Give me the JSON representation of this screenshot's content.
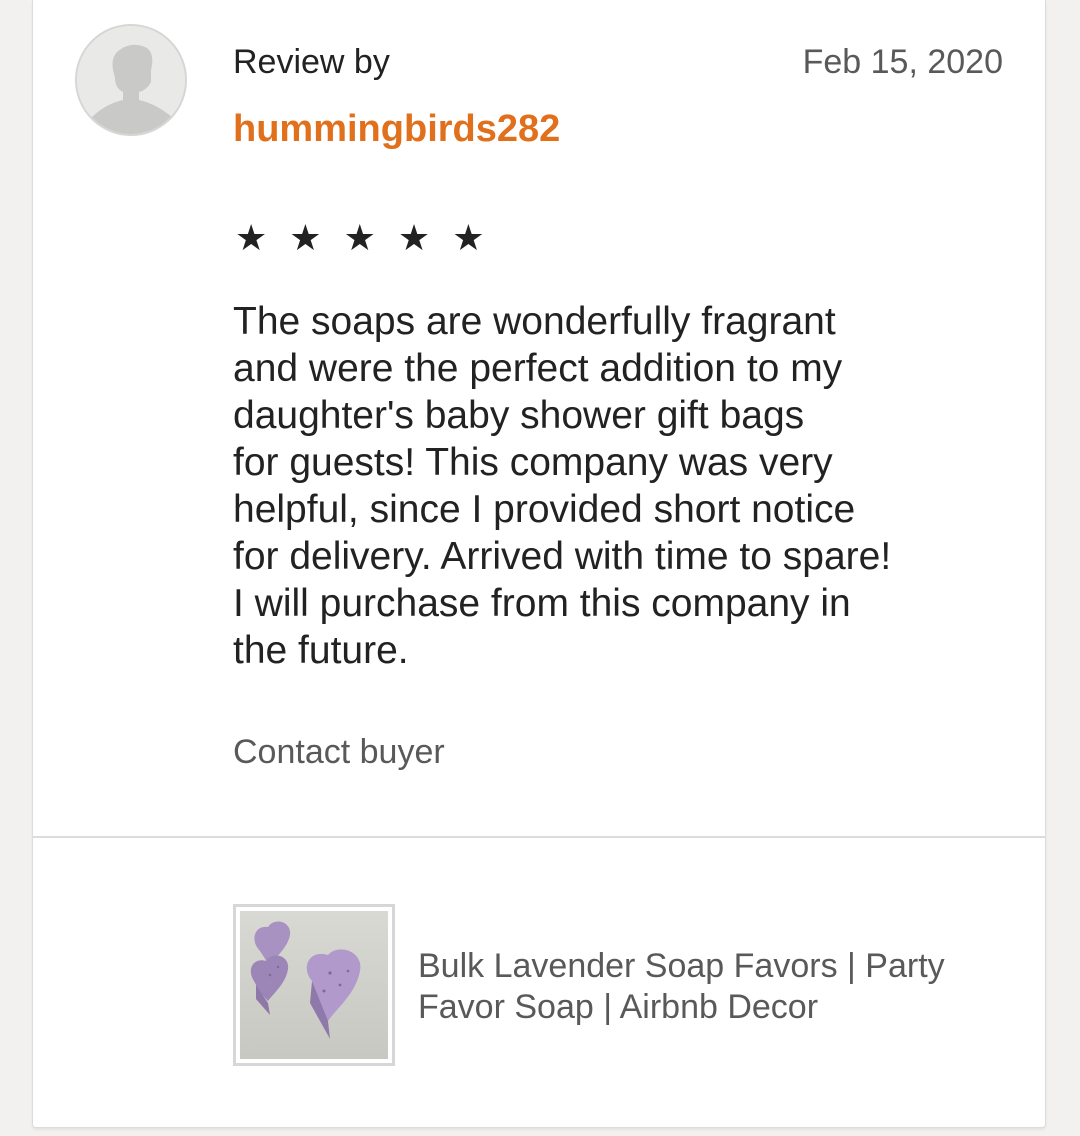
{
  "review": {
    "review_by_label": "Review by",
    "date": "Feb 15, 2020",
    "username": "hummingbirds282",
    "rating": 5,
    "stars": [
      "★",
      "★",
      "★",
      "★",
      "★"
    ],
    "text": "The soaps are wonderfully fragrant\nand were the perfect addition to my\ndaughter's baby shower gift bags\nfor guests!  This company was very\nhelpful, since I provided short notice\nfor delivery. Arrived with time to spare!\nI will purchase from this company in\nthe future.",
    "contact_label": "Contact buyer"
  },
  "listing": {
    "title": "Bulk Lavender Soap Favors | Party\nFavor Soap | Airbnb Decor"
  },
  "colors": {
    "username": "#e0701c",
    "text": "#222222",
    "muted": "#595959",
    "background": "#f2f1ef"
  },
  "icons": {
    "avatar": "default-user-silhouette-icon",
    "star": "star-icon"
  }
}
